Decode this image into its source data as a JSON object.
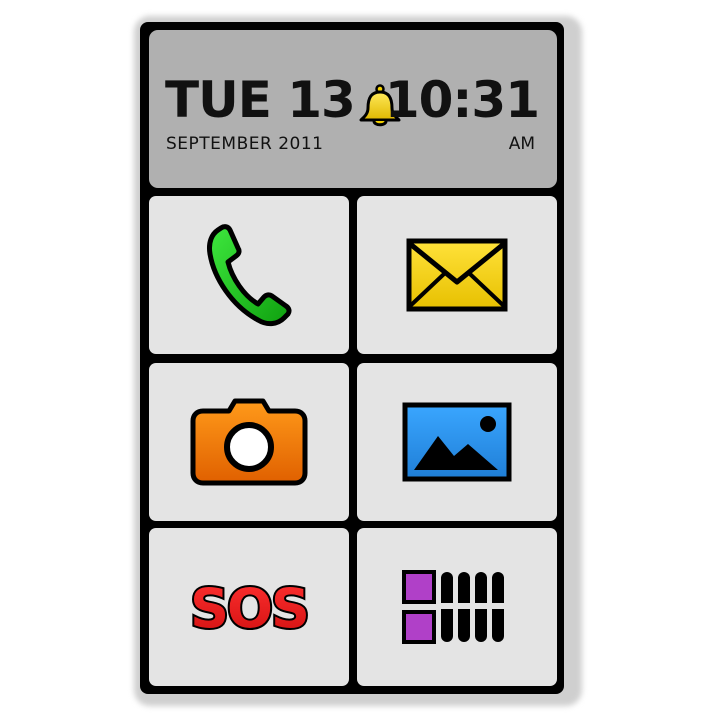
{
  "status": {
    "day": "TUE 13",
    "month_year": "SEPTEMBER 2011",
    "time": "10:31",
    "period": "AM",
    "alarm_icon": "bell-icon"
  },
  "tiles": [
    {
      "name": "phone",
      "icon": "phone-handset-icon",
      "color": "#16c616"
    },
    {
      "name": "messages",
      "icon": "envelope-icon",
      "color": "#f2d000"
    },
    {
      "name": "camera",
      "icon": "camera-icon",
      "color": "#f07a00"
    },
    {
      "name": "gallery",
      "icon": "picture-icon",
      "color": "#2a90e8"
    },
    {
      "name": "sos",
      "label": "SOS",
      "color": "#e41f1f"
    },
    {
      "name": "apps",
      "icon": "app-grid-icon",
      "color": "#b040c8"
    }
  ],
  "colors": {
    "frame": "#000000",
    "header_bg": "#b0b0b0",
    "tile_bg": "#e4e4e4"
  }
}
